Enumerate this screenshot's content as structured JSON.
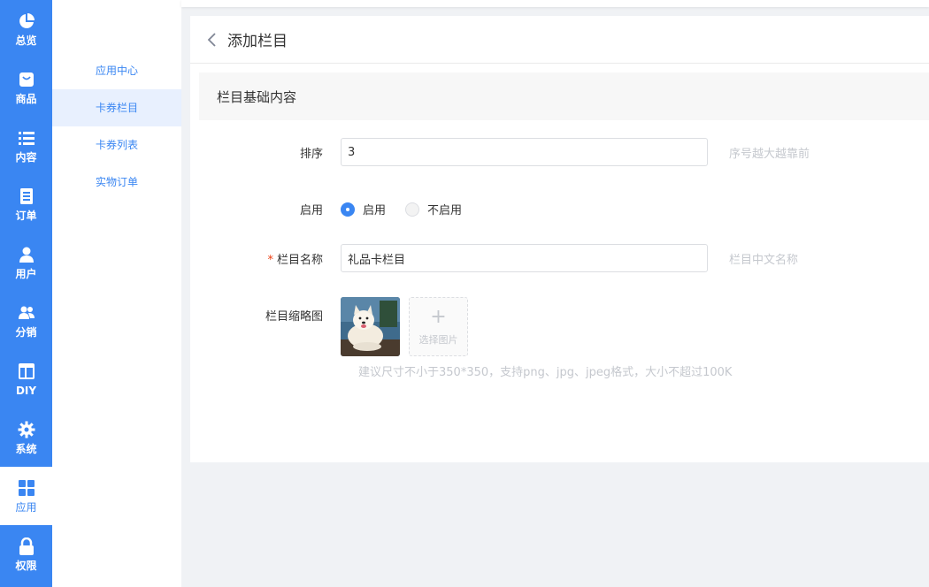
{
  "nav": {
    "items": [
      {
        "label": "总览",
        "icon": "pie-chart-icon"
      },
      {
        "label": "商品",
        "icon": "shopping-bag-icon"
      },
      {
        "label": "内容",
        "icon": "list-icon"
      },
      {
        "label": "订单",
        "icon": "order-doc-icon"
      },
      {
        "label": "用户",
        "icon": "user-icon"
      },
      {
        "label": "分销",
        "icon": "group-icon"
      },
      {
        "label": "DIY",
        "icon": "layout-icon"
      },
      {
        "label": "系统",
        "icon": "gear-icon"
      },
      {
        "label": "应用",
        "icon": "grid-icon"
      },
      {
        "label": "权限",
        "icon": "lock-icon"
      }
    ],
    "active_index": 8
  },
  "subnav": {
    "items": [
      {
        "label": "应用中心"
      },
      {
        "label": "卡券栏目"
      },
      {
        "label": "卡券列表"
      },
      {
        "label": "实物订单"
      }
    ],
    "active_index": 1
  },
  "page": {
    "title": "添加栏目",
    "section_title": "栏目基础内容"
  },
  "form": {
    "sort": {
      "label": "排序",
      "value": "3",
      "hint": "序号越大越靠前"
    },
    "enable": {
      "label": "启用",
      "options": [
        "启用",
        "不启用"
      ],
      "selected": "启用"
    },
    "name": {
      "label": "栏目名称",
      "required_mark": "*",
      "value": "礼品卡栏目",
      "hint": "栏目中文名称"
    },
    "thumbnail": {
      "label": "栏目缩略图",
      "picker_label": "选择图片",
      "picker_icon": "plus-icon",
      "hint": "建议尺寸不小于350*350，支持png、jpg、jpeg格式，大小不超过100K"
    }
  },
  "colors": {
    "primary": "#3a86f2",
    "required": "#ed4014",
    "hint": "#c5c8ce"
  }
}
